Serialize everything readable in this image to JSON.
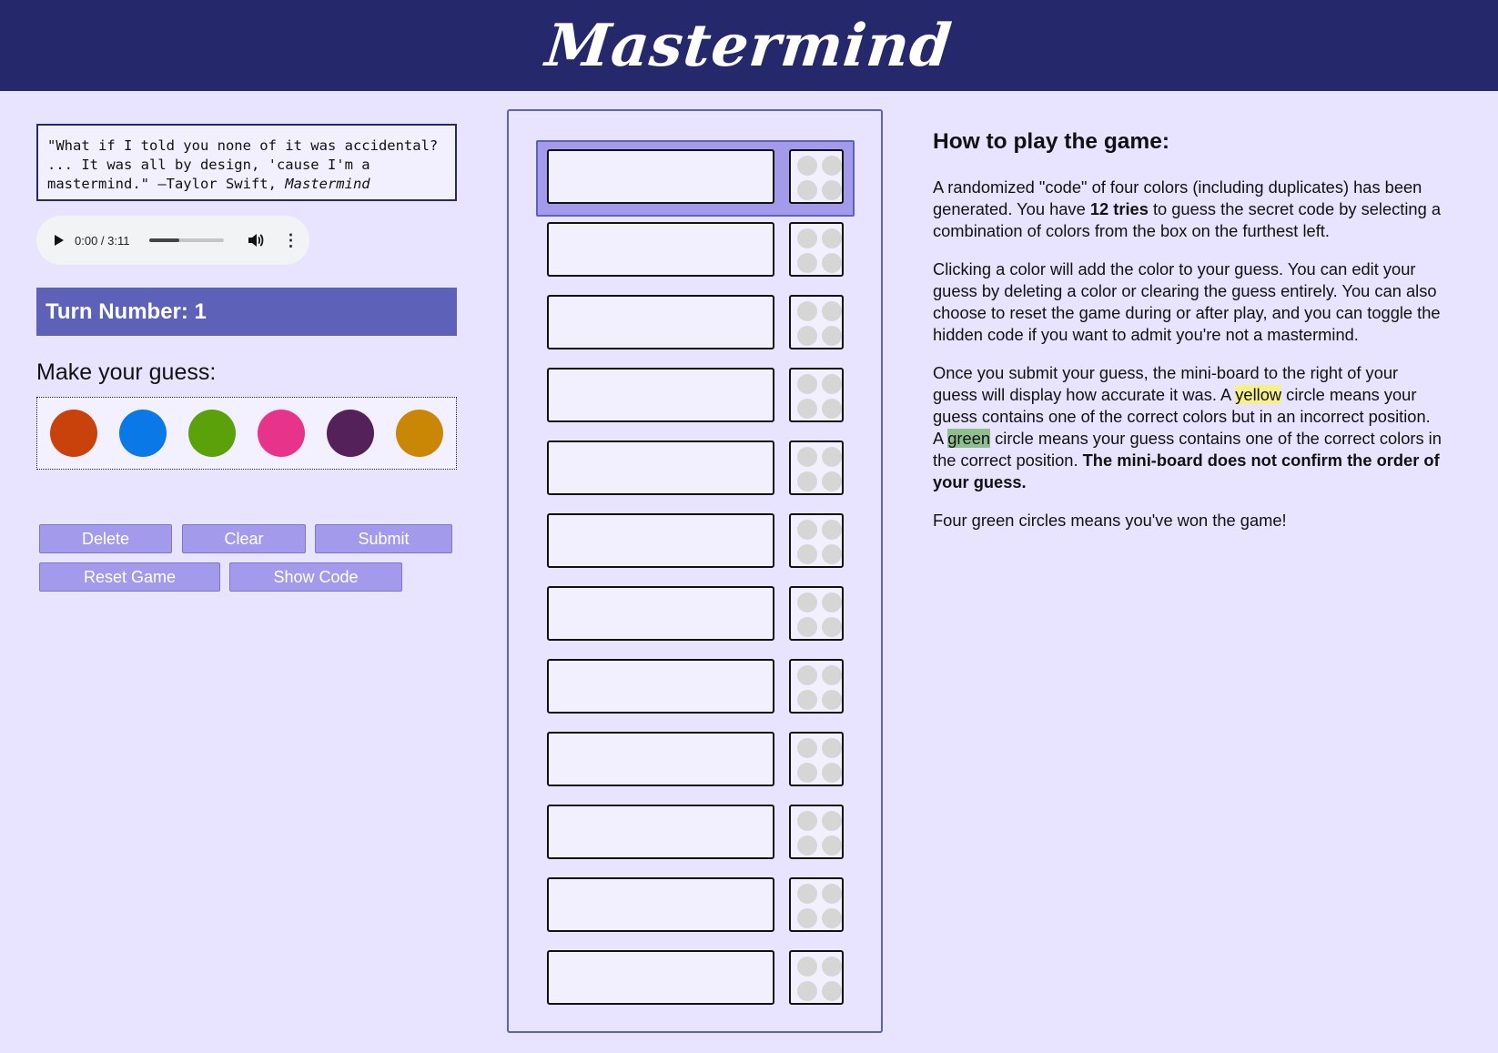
{
  "header": {
    "title": "Mastermind"
  },
  "quote": {
    "text": "\"What if I told you none of it was accidental? ... It was all by design, 'cause I'm a mastermind.\" —Taylor Swift, ",
    "source": "Mastermind"
  },
  "audio": {
    "time": "0:00 / 3:11",
    "progress": 0.4
  },
  "turn": {
    "label": "Turn Number: 1"
  },
  "guess_prompt": "Make your guess:",
  "palette": {
    "colors": [
      {
        "name": "orange",
        "hex": "#c9420b"
      },
      {
        "name": "blue",
        "hex": "#0a78e6"
      },
      {
        "name": "green",
        "hex": "#5aa10a"
      },
      {
        "name": "pink",
        "hex": "#e8338a"
      },
      {
        "name": "purple",
        "hex": "#54215a"
      },
      {
        "name": "gold",
        "hex": "#c98705"
      }
    ]
  },
  "buttons": {
    "delete": "Delete",
    "clear": "Clear",
    "submit": "Submit",
    "reset": "Reset Game",
    "show_code": "Show Code"
  },
  "board": {
    "rows": 12,
    "active_row": 1
  },
  "howto": {
    "title": "How to play the game:",
    "p1_a": "A randomized \"code\" of four colors (including duplicates) has been generated. You have ",
    "p1_b": "12 tries",
    "p1_c": " to guess the secret code by selecting a combination of colors from the box on the furthest left.",
    "p2": "Clicking a color will add the color to your guess. You can edit your guess by deleting a color or clearing the guess entirely. You can also choose to reset the game during or after play, and you can toggle the hidden code if you want to admit you're not a mastermind.",
    "p3_a": "Once you submit your guess, the mini-board to the right of your guess will display how accurate it was. A ",
    "p3_yellow": "yellow",
    "p3_b": " circle means your guess contains one of the correct colors but in an incorrect position. A ",
    "p3_green": "green",
    "p3_c": " circle means your guess contains one of the correct colors in the correct position. ",
    "p3_bold": "The mini-board does not confirm the order of your guess.",
    "p4": "Four green circles means you've won the game!"
  }
}
